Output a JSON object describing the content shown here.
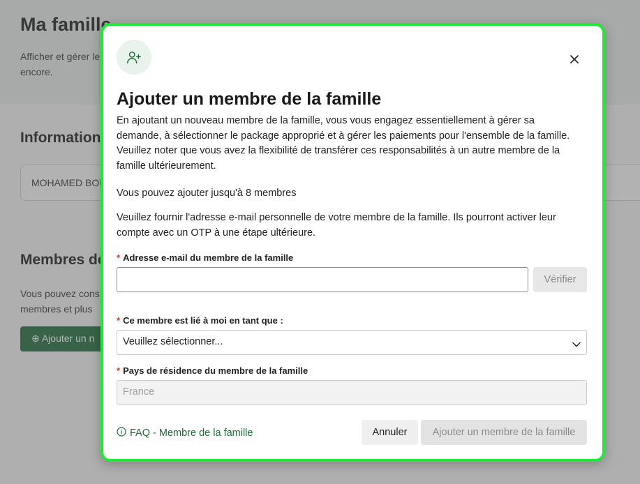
{
  "background": {
    "page_title": "Ma famille",
    "page_description": "Afficher et gérer le encore.",
    "info_heading": "Informations",
    "info_name": "MOHAMED BOU",
    "members_heading": "Membres de",
    "members_text": "Vous pouvez cons membres et plus",
    "add_button_label": "Ajouter un n"
  },
  "modal": {
    "icon": "user-plus-icon",
    "close_icon": "close-icon",
    "title": "Ajouter un membre de la famille",
    "paragraph_1": "En ajoutant un nouveau membre de la famille, vous vous engagez essentiellement à gérer sa demande, à sélectionner le package approprié et à gérer les paiements pour l'ensemble de la famille. Veuillez noter que vous avez la flexibilité de transférer ces responsabilités à un autre membre de la famille ultérieurement.",
    "paragraph_2": "Vous pouvez ajouter jusqu'à 8 membres",
    "paragraph_3": "Veuillez fournir l'adresse e-mail personnelle de votre membre de la famille. Ils pourront activer leur compte avec un OTP à une étape ultérieure.",
    "required_mark": "*",
    "email_label": "Adresse e-mail du membre de la famille",
    "email_value": "",
    "verify_label": "Vérifier",
    "relation_label": "Ce membre est lié à moi en tant que :",
    "relation_selected": "Veuillez sélectionner...",
    "country_label": "Pays de résidence du membre de la famille",
    "country_placeholder": "France",
    "faq_label": "FAQ - Membre de la famille",
    "cancel_label": "Annuler",
    "submit_label": "Ajouter un membre de la famille"
  },
  "colors": {
    "accent": "#1e6b3a",
    "focus_border": "#22e83a",
    "required": "#d63b2f"
  }
}
